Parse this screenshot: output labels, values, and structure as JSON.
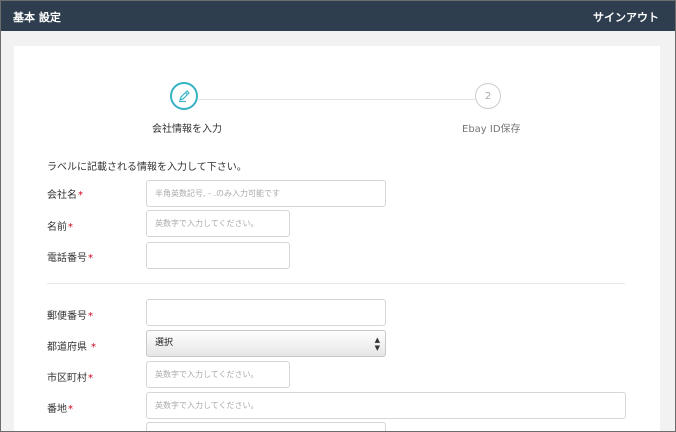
{
  "header": {
    "title": "基本 設定",
    "logout_label": "サインアウト"
  },
  "stepper": {
    "steps": [
      {
        "number": "",
        "label": "会社情報を入力",
        "state": "active",
        "icon": "pencil-icon"
      },
      {
        "number": "2",
        "label": "Ebay ID保存",
        "state": "inactive"
      }
    ]
  },
  "form": {
    "intro": "ラベルに記載される情報を入力して下さい。",
    "required_mark": "*",
    "fields": {
      "company_name": {
        "label": "会社名",
        "placeholder": "半角英数記号, - .のみ入力可能です"
      },
      "name": {
        "label": "名前",
        "placeholder": "英数字で入力してください。"
      },
      "phone": {
        "label": "電話番号",
        "placeholder": ""
      },
      "postal_code": {
        "label": "郵便番号",
        "placeholder": ""
      },
      "prefecture": {
        "label": "都道府県",
        "selected": "選択"
      },
      "city": {
        "label": "市区町村",
        "placeholder": "英数字で入力してください。"
      },
      "address": {
        "label": "番地",
        "placeholder": "英数字で入力してください。"
      }
    }
  },
  "colors": {
    "header_bg": "#2e3e4e",
    "accent": "#34b3c7",
    "required": "#d0021b"
  }
}
